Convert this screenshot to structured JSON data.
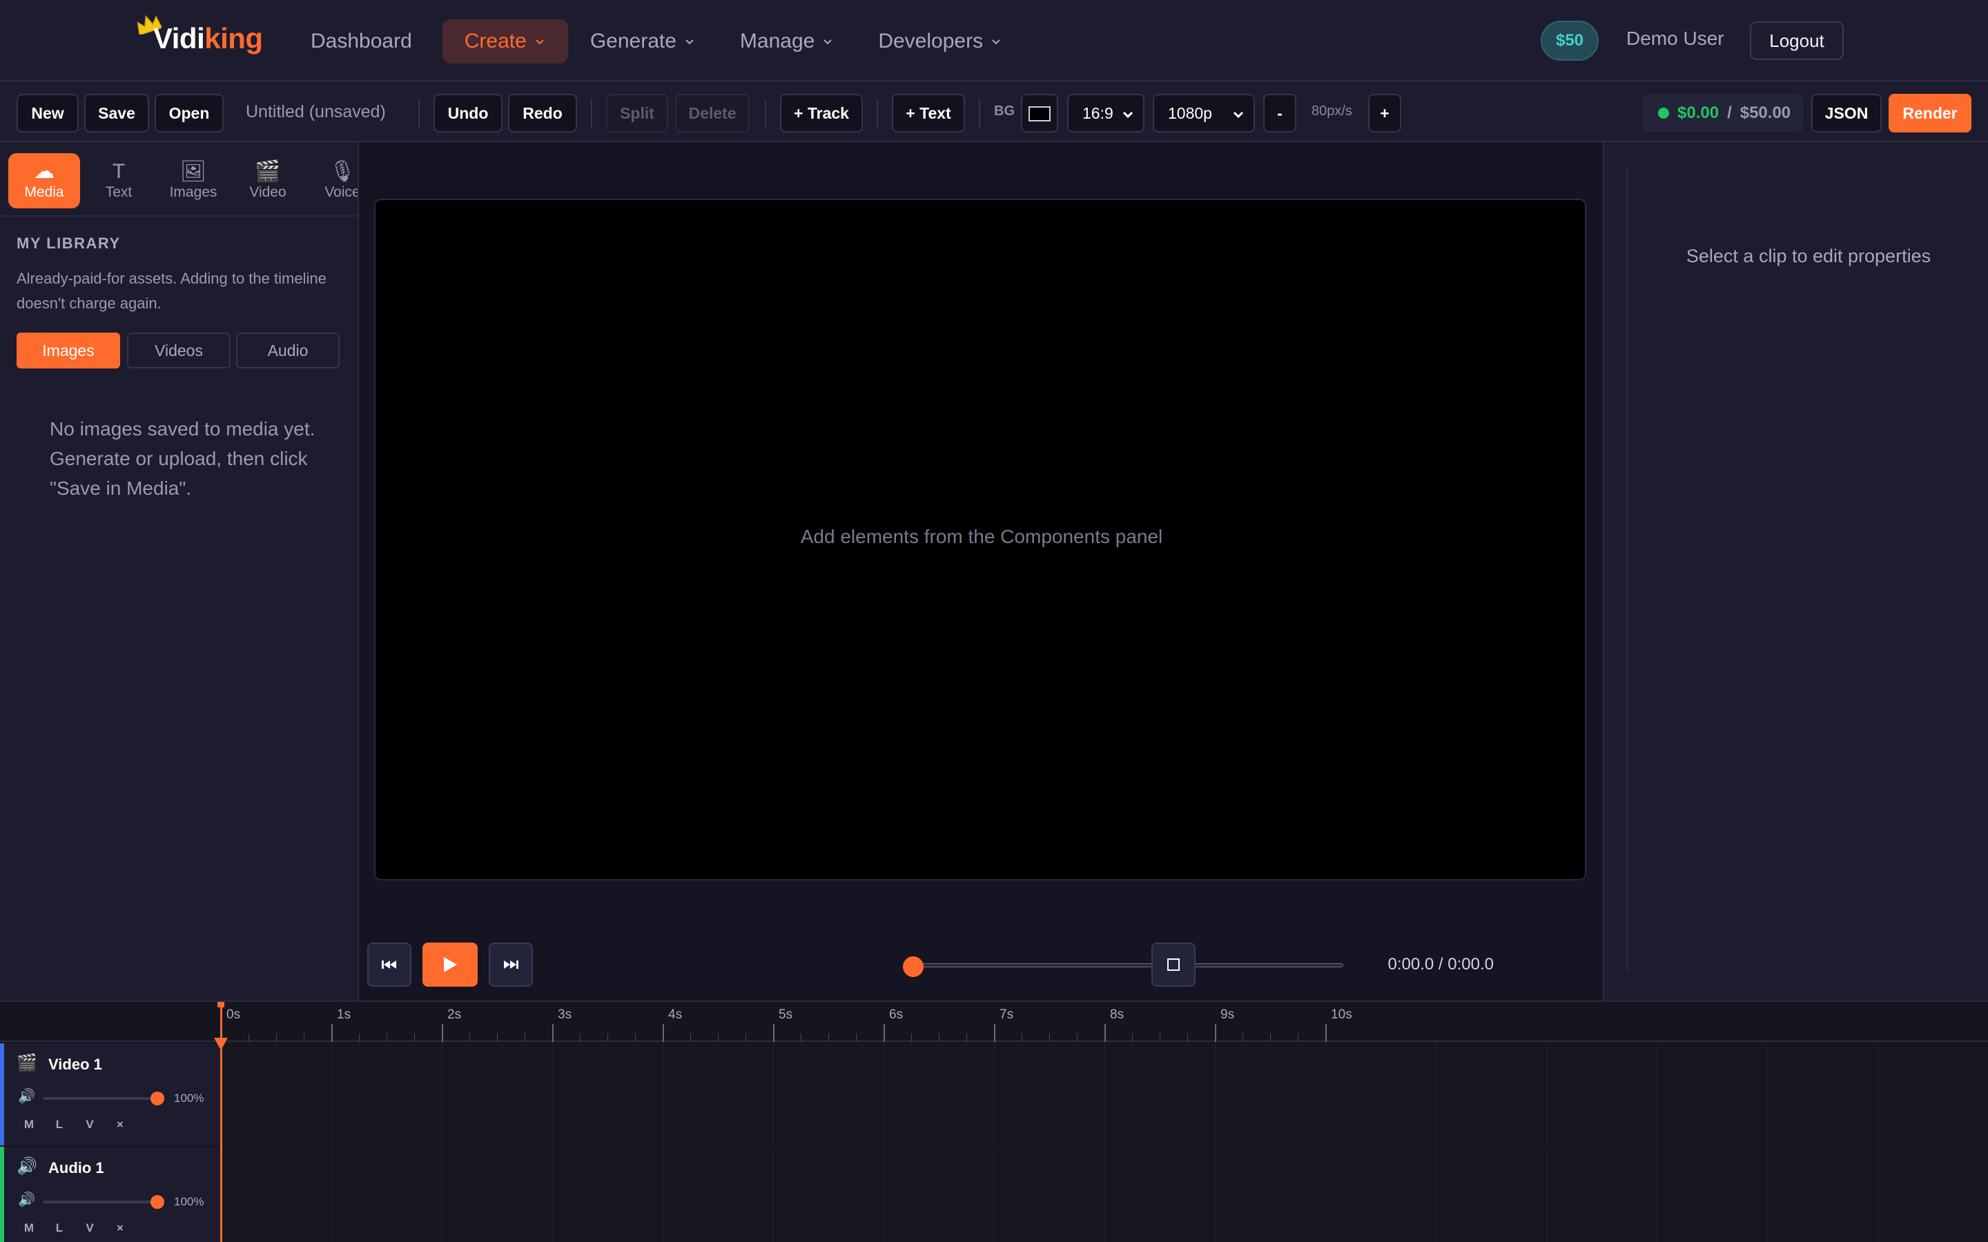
{
  "brand": {
    "part1": "Vidi",
    "part2": "king",
    "accent": "#ff6b2c"
  },
  "nav": {
    "dashboard": "Dashboard",
    "create": "Create",
    "generate": "Generate",
    "manage": "Manage",
    "developers": "Developers",
    "credits": "$50",
    "user": "Demo User",
    "logout": "Logout"
  },
  "toolbar": {
    "new": "New",
    "save": "Save",
    "open": "Open",
    "project_title": "Untitled (unsaved)",
    "undo": "Undo",
    "redo": "Redo",
    "split": "Split",
    "delete": "Delete",
    "add_track": "+ Track",
    "add_text": "+ Text",
    "bg_label": "BG",
    "bg_color": "#000000",
    "aspect": "16:9",
    "resolution": "1080p",
    "zoom_out": "-",
    "zoom_level": "80px/s",
    "zoom_in": "+",
    "cost_used": "$0.00",
    "cost_sep": "/",
    "cost_total": "$50.00",
    "json": "JSON",
    "render": "Render"
  },
  "components": {
    "tabs": [
      {
        "label": "Media",
        "icon": "cloud-icon",
        "glyph": "☁"
      },
      {
        "label": "Text",
        "icon": "text-icon",
        "glyph": "T"
      },
      {
        "label": "Images",
        "icon": "image-icon",
        "glyph": "🖼"
      },
      {
        "label": "Video",
        "icon": "clapper-icon",
        "glyph": "🎬"
      },
      {
        "label": "Voice",
        "icon": "microphone-icon",
        "glyph": "🎙"
      }
    ],
    "library_title": "MY LIBRARY",
    "library_desc": "Already-paid-for assets. Adding to the timeline doesn't charge again.",
    "subtabs": [
      "Images",
      "Videos",
      "Audio"
    ],
    "empty_message": "No images saved to media yet. Generate or upload, then click \"Save in Media\"."
  },
  "preview": {
    "hint": "Add elements from the Components panel",
    "time": "0:00.0 / 0:00.0",
    "progress": 0
  },
  "properties": {
    "empty_message": "Select a clip to edit properties"
  },
  "timeline": {
    "ticks": [
      "0s",
      "1s",
      "2s",
      "3s",
      "4s",
      "5s",
      "6s",
      "7s",
      "8s",
      "9s",
      "10s"
    ],
    "tracks": [
      {
        "name": "Video 1",
        "icon": "clapper-icon",
        "glyph": "🎬",
        "color": "#3b6fe8",
        "volume": "100%",
        "controls": [
          "M",
          "L",
          "V",
          "×"
        ]
      },
      {
        "name": "Audio 1",
        "icon": "speaker-icon",
        "glyph": "🔊",
        "color": "#22c55e",
        "volume": "100%",
        "controls": [
          "M",
          "L",
          "V",
          "×"
        ]
      }
    ]
  }
}
